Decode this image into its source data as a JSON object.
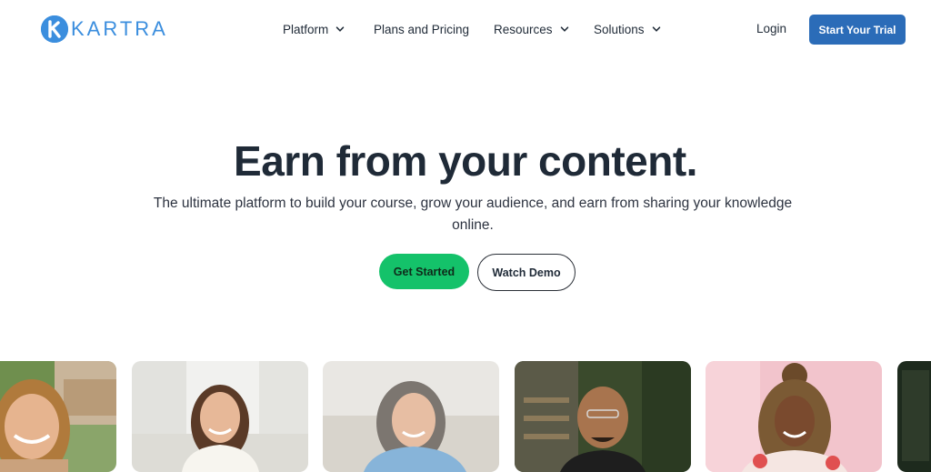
{
  "brand": {
    "name": "KARTRA",
    "color": "#3b8ede"
  },
  "nav": {
    "items": [
      {
        "label": "Platform",
        "has_dropdown": true
      },
      {
        "label": "Plans and Pricing",
        "has_dropdown": false
      },
      {
        "label": "Resources",
        "has_dropdown": true
      },
      {
        "label": "Solutions",
        "has_dropdown": true
      }
    ],
    "login_label": "Login",
    "trial_label": "Start Your Trial"
  },
  "hero": {
    "title": "Earn from your content.",
    "subtitle": "The ultimate platform to build your course, grow your audience, and earn from sharing your knowledge online.",
    "primary_cta": "Get Started",
    "secondary_cta": "Watch Demo"
  },
  "colors": {
    "primary_blue": "#2b6cb8",
    "cta_green": "#14c26a",
    "text_dark": "#1f2a37"
  },
  "photos": [
    {
      "name": "creator-photo-1"
    },
    {
      "name": "creator-photo-2"
    },
    {
      "name": "creator-photo-3"
    },
    {
      "name": "creator-photo-4"
    },
    {
      "name": "creator-photo-5"
    },
    {
      "name": "creator-photo-6"
    }
  ]
}
